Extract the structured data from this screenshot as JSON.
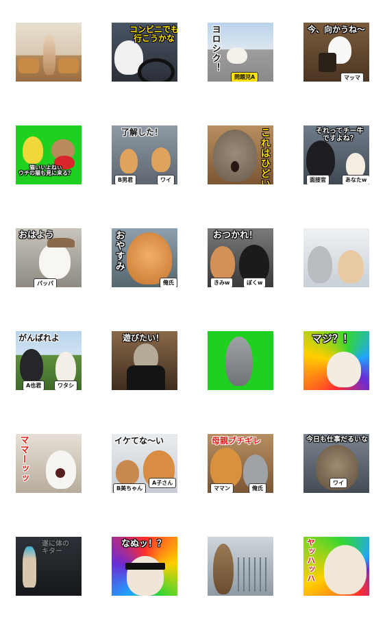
{
  "stickers": [
    {
      "caption": "",
      "tags": []
    },
    {
      "caption": "コンビニでも\n行こうかな",
      "tags": []
    },
    {
      "caption": "ヨロシク！",
      "tags": [
        "問題児A"
      ]
    },
    {
      "caption": "今、向かうね～",
      "tags": [
        "マッマ"
      ]
    },
    {
      "caption": "猫いいよねぃ\nウチの猫も見に来る？",
      "tags": []
    },
    {
      "caption": "了解した！",
      "tags": [
        "B男君",
        "ワイ"
      ]
    },
    {
      "caption": "これはひどい",
      "tags": []
    },
    {
      "caption": "それってチー牛\nですよね？",
      "tags": [
        "面接官",
        "あなたw"
      ]
    },
    {
      "caption": "おはよう",
      "tags": [
        "パッパ"
      ]
    },
    {
      "caption": "おやすみ",
      "tags": [
        "俺氏"
      ]
    },
    {
      "caption": "おつかれ！",
      "tags": [
        "きみw",
        "ぼくw"
      ]
    },
    {
      "caption": "",
      "tags": []
    },
    {
      "caption": "がんばれよ",
      "tags": [
        "A也君",
        "ワタシ"
      ]
    },
    {
      "caption": "遊びたい！",
      "tags": []
    },
    {
      "caption": "",
      "tags": []
    },
    {
      "caption": "マジ？！",
      "tags": []
    },
    {
      "caption": "ママーッッ",
      "tags": []
    },
    {
      "caption": "イケてな～い",
      "tags": [
        "B美ちゃん",
        "A子さん"
      ]
    },
    {
      "caption": "母親ブチギレ",
      "tags": [
        "ママン",
        "俺氏"
      ]
    },
    {
      "caption": "今日も仕事だるいな",
      "tags": [
        "ワイ"
      ]
    },
    {
      "caption": "遂に体の\nキター",
      "tags": []
    },
    {
      "caption": "なぬッ！？",
      "tags": []
    },
    {
      "caption": "",
      "tags": []
    },
    {
      "caption": "ヤッハッハ",
      "tags": []
    }
  ]
}
